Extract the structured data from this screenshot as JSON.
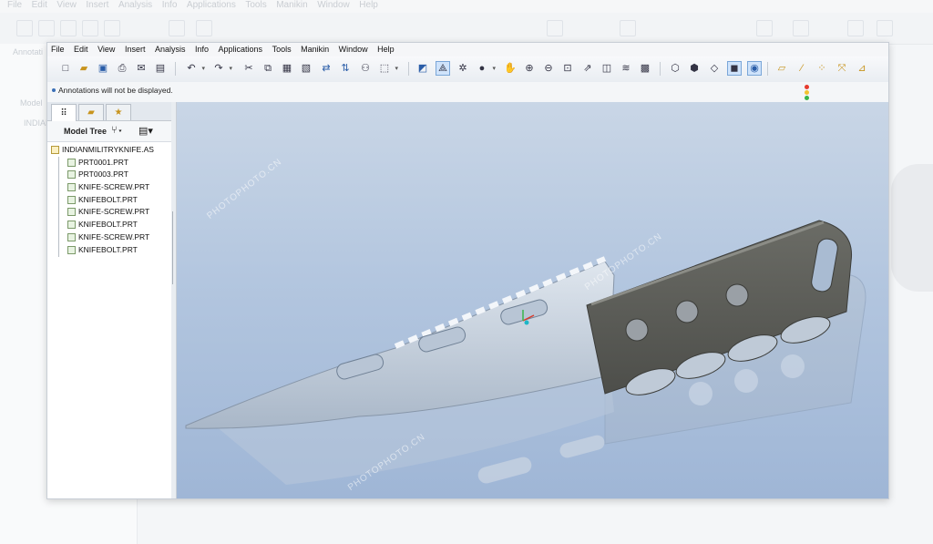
{
  "menu": [
    "File",
    "Edit",
    "View",
    "Insert",
    "Analysis",
    "Info",
    "Applications",
    "Tools",
    "Manikin",
    "Window",
    "Help"
  ],
  "toolbar_icons": [
    "new-icon",
    "open-icon",
    "save-icon",
    "print-icon",
    "send-icon",
    "display-icon",
    "undo-icon",
    "redo-icon",
    "cut-icon",
    "copy-icon",
    "paste-icon",
    "paste-special-icon",
    "regenerate-icon",
    "regenerate-manager-icon",
    "find-icon",
    "select-box-icon",
    "sketch-view-icon",
    "datum-display-icon",
    "spin-center-icon",
    "shading-icon",
    "pan-icon",
    "zoom-in-icon",
    "zoom-out-icon",
    "refit-icon",
    "reorient-icon",
    "saved-views-icon",
    "layers-icon",
    "appearance-icon",
    "wireframe-icon",
    "hidden-line-icon",
    "no-hidden-icon",
    "shading-mode-icon",
    "enhanced-realism-icon",
    "datum-plane-icon",
    "datum-axis-icon",
    "datum-point-icon",
    "csys-icon",
    "annotation-icon"
  ],
  "message": "Annotations will not be displayed.",
  "status_colors": {
    "top": "#e63b2e",
    "mid": "#f2c230",
    "bottom": "#39b54a"
  },
  "model_tree": {
    "title": "Model Tree",
    "root": "INDIANMILITRYKNIFE.AS",
    "items": [
      "PRT0001.PRT",
      "PRT0003.PRT",
      "KNIFE-SCREW.PRT",
      "KNIFEBOLT.PRT",
      "KNIFE-SCREW.PRT",
      "KNIFEBOLT.PRT",
      "KNIFE-SCREW.PRT",
      "KNIFEBOLT.PRT"
    ]
  },
  "watermark": "PHOTOPHOTO.CN",
  "background_ui": {
    "menu": [
      "File",
      "Edit",
      "View",
      "Insert",
      "Analysis",
      "Info",
      "Applications",
      "Tools",
      "Manikin",
      "Window",
      "Help"
    ],
    "panel_label": "Model",
    "panel_root": "INDIAN",
    "message": "Annotati"
  },
  "colors": {
    "viewport_top": "#c9d6e6",
    "viewport_bottom": "#9fb6d6",
    "blade": "#c4cfdb",
    "handle": "#5c5d58"
  }
}
